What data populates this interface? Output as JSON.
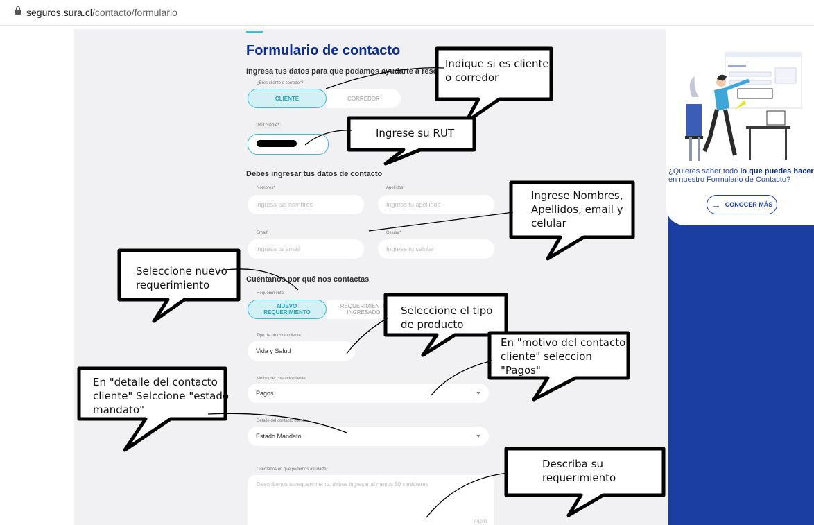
{
  "browser": {
    "url_host": "seguros.sura.cl",
    "url_path": "/contacto/formulario"
  },
  "form": {
    "title": "Formulario de contacto",
    "subtitle": "Ingresa tus datos para que podamos ayudarte a resolver",
    "client_type_label": "¿Eres cliente o corredor?",
    "client_type_options": [
      "CLIENTE",
      "CORREDOR"
    ],
    "rut_label": "Rut cliente*",
    "contact_section": "Debes ingresar tus datos de contacto",
    "nombres_label": "Nombres*",
    "nombres_placeholder": "Ingresa tus nombres",
    "apellidos_label": "Apellidos*",
    "apellidos_placeholder": "Ingresa tu apellidos",
    "email_label": "Email*",
    "email_placeholder": "Ingresa tu email",
    "celular_label": "Celular*",
    "celular_placeholder": "Ingresa tu celular",
    "reason_section": "Cuéntanos por qué nos contactas",
    "req_label": "Requerimiento",
    "req_new_1": "NUEVO",
    "req_new_2": "REQUERIMIENTO",
    "req_old_1": "REQUERIMIENTO",
    "req_old_2": "INGRESADO",
    "product_label": "Tipo de producto cliente",
    "product_value": "Vida y Salud",
    "motivo_label": "Motivo del contacto cliente",
    "motivo_value": "Pagos",
    "detalle_label": "Detalle del contacto cliente",
    "detalle_value": "Estado Mandato",
    "help_label": "Cuéntanos en qué podemos ayudarte*",
    "help_placeholder": "Descríbenos tu requerimiento, debes ingresar al menos 50 carácteres",
    "counter": "0/1000"
  },
  "promo": {
    "text_1": "¿Quieres saber todo ",
    "text_bold": "lo que puedes hacer",
    "text_2": " en nuestro Formulario de Contacto?",
    "button_label": "CONOCER MÁS"
  },
  "callouts": {
    "cliente": [
      "Indique si es cliente",
      "o corredor"
    ],
    "rut": [
      "Ingrese su RUT"
    ],
    "nombres": [
      "Ingrese Nombres,",
      "Apellidos, email y",
      "celular"
    ],
    "nuevo": [
      "Seleccione nuevo",
      "requerimiento"
    ],
    "producto": [
      "Seleccione el tipo",
      "de producto"
    ],
    "motivo": [
      "En \"motivo del contacto",
      "cliente\" seleccion",
      "\"Pagos\""
    ],
    "detalle": [
      "En \"detalle del contacto",
      "cliente\" Selccione \"estado",
      "mandato\""
    ],
    "describa": [
      "Describa su",
      "requerimiento"
    ]
  }
}
